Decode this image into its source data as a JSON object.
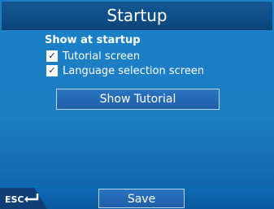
{
  "window": {
    "title": "Startup"
  },
  "startup": {
    "section_label": "Show at startup",
    "options": [
      {
        "label": "Tutorial screen",
        "checked": true
      },
      {
        "label": "Language selection screen",
        "checked": true
      }
    ],
    "show_tutorial_label": "Show Tutorial"
  },
  "footer": {
    "esc_label": "ESC",
    "save_label": "Save"
  },
  "icons": {
    "back": "enter-arrow-icon",
    "checkmark": "checkmark-icon"
  },
  "colors": {
    "background": "#1a7fc7",
    "title_bar": "#0f4f89",
    "text": "#ffffff",
    "button_border": "#b9d6f2"
  }
}
